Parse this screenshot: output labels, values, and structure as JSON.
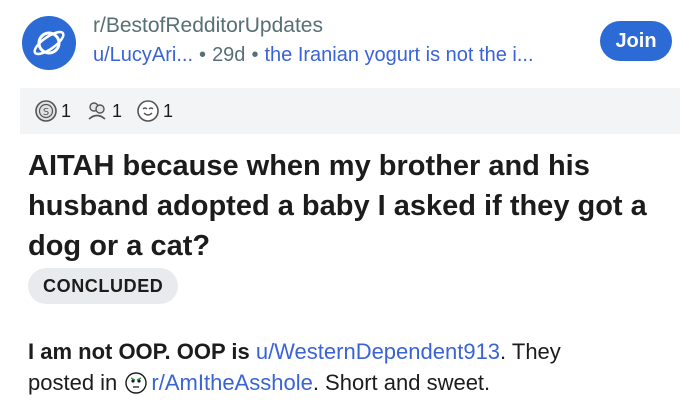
{
  "header": {
    "subreddit": "r/BestofRedditorUpdates",
    "author": "u/LucyAri...",
    "age": "29d",
    "flair_text": "the Iranian yogurt is not the i...",
    "join_label": "Join"
  },
  "awards": [
    {
      "icon": "silver-award-icon",
      "count": "1"
    },
    {
      "icon": "helpful-award-icon",
      "count": "1"
    },
    {
      "icon": "wholesome-award-icon",
      "count": "1"
    }
  ],
  "post": {
    "title": "AITAH because when my brother and his husband adopted a baby I asked if they got a dog or a cat?",
    "flair": "CONCLUDED",
    "body_bold": "I am not OOP. OOP is",
    "oop_link": "u/WesternDependent913",
    "body_mid1": ". They",
    "body_mid2": "posted in",
    "sub_link": "r/AmItheAsshole",
    "body_end": ". Short and sweet."
  },
  "colors": {
    "accent": "#2c6ad6",
    "link": "#3a63d6",
    "meta": "#576f76",
    "award_bar": "#f2f4f5",
    "chip": "#e8ebed"
  }
}
